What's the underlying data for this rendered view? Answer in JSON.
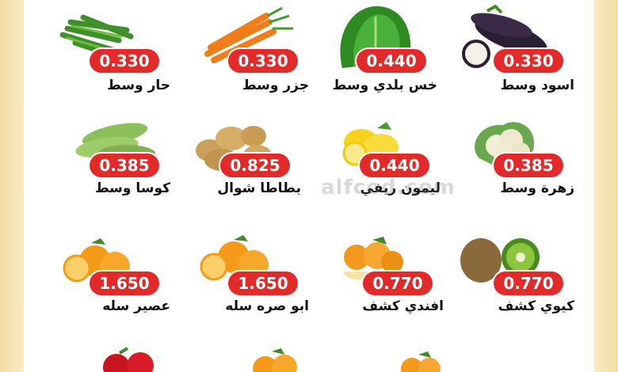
{
  "watermark": "alfcod.com",
  "products": [
    {
      "name": "حار وسط",
      "price": "0.330",
      "icon": "green-beans-icon"
    },
    {
      "name": "جزر وسط",
      "price": "0.330",
      "icon": "carrot-icon"
    },
    {
      "name": "خس بلدي وسط",
      "price": "0.440",
      "icon": "lettuce-icon"
    },
    {
      "name": "اسود وسط",
      "price": "0.330",
      "icon": "eggplant-icon"
    },
    {
      "name": "كوسا وسط",
      "price": "0.385",
      "icon": "zucchini-icon"
    },
    {
      "name": "بطاطا شوال",
      "price": "0.825",
      "icon": "potato-icon"
    },
    {
      "name": "ليمون ريفي",
      "price": "0.440",
      "icon": "lemon-icon"
    },
    {
      "name": "زهرة وسط",
      "price": "0.385",
      "icon": "cauliflower-icon"
    },
    {
      "name": "عصير سله",
      "price": "1.650",
      "icon": "orange-icon"
    },
    {
      "name": "ابو صره سله",
      "price": "1.650",
      "icon": "navel-orange-icon"
    },
    {
      "name": "افندي كشف",
      "price": "0.770",
      "icon": "mandarin-icon"
    },
    {
      "name": "كيوي كشف",
      "price": "0.770",
      "icon": "kiwi-icon"
    }
  ],
  "colors": {
    "price_badge": "#e32a2a",
    "frame": "#f6e7b4"
  }
}
